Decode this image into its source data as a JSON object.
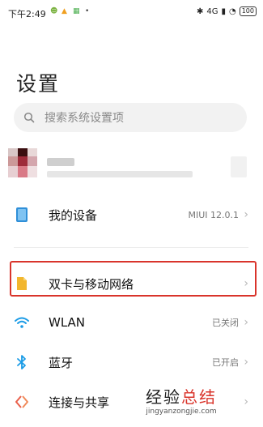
{
  "status_bar": {
    "time": "下午2:49",
    "right_text": "4G",
    "battery": "100"
  },
  "page": {
    "title": "设置"
  },
  "search": {
    "placeholder": "搜索系统设置项"
  },
  "rows": [
    {
      "label": "我的设备",
      "value": "MIUI 12.0.1",
      "icon": "device-icon"
    },
    {
      "label": "双卡与移动网络",
      "value": "",
      "icon": "sim-card-icon"
    },
    {
      "label": "WLAN",
      "value": "已关闭",
      "icon": "wifi-icon"
    },
    {
      "label": "蓝牙",
      "value": "已开启",
      "icon": "bluetooth-icon"
    },
    {
      "label": "连接与共享",
      "value": "",
      "icon": "share-icon"
    }
  ],
  "watermark": {
    "text": "经验总结",
    "url": "jingyanzongjie.com"
  },
  "colors": {
    "highlight": "#d9342b",
    "search_bg": "#f2f2f2",
    "wifi": "#1a9be6",
    "sim": "#f2b62e"
  }
}
